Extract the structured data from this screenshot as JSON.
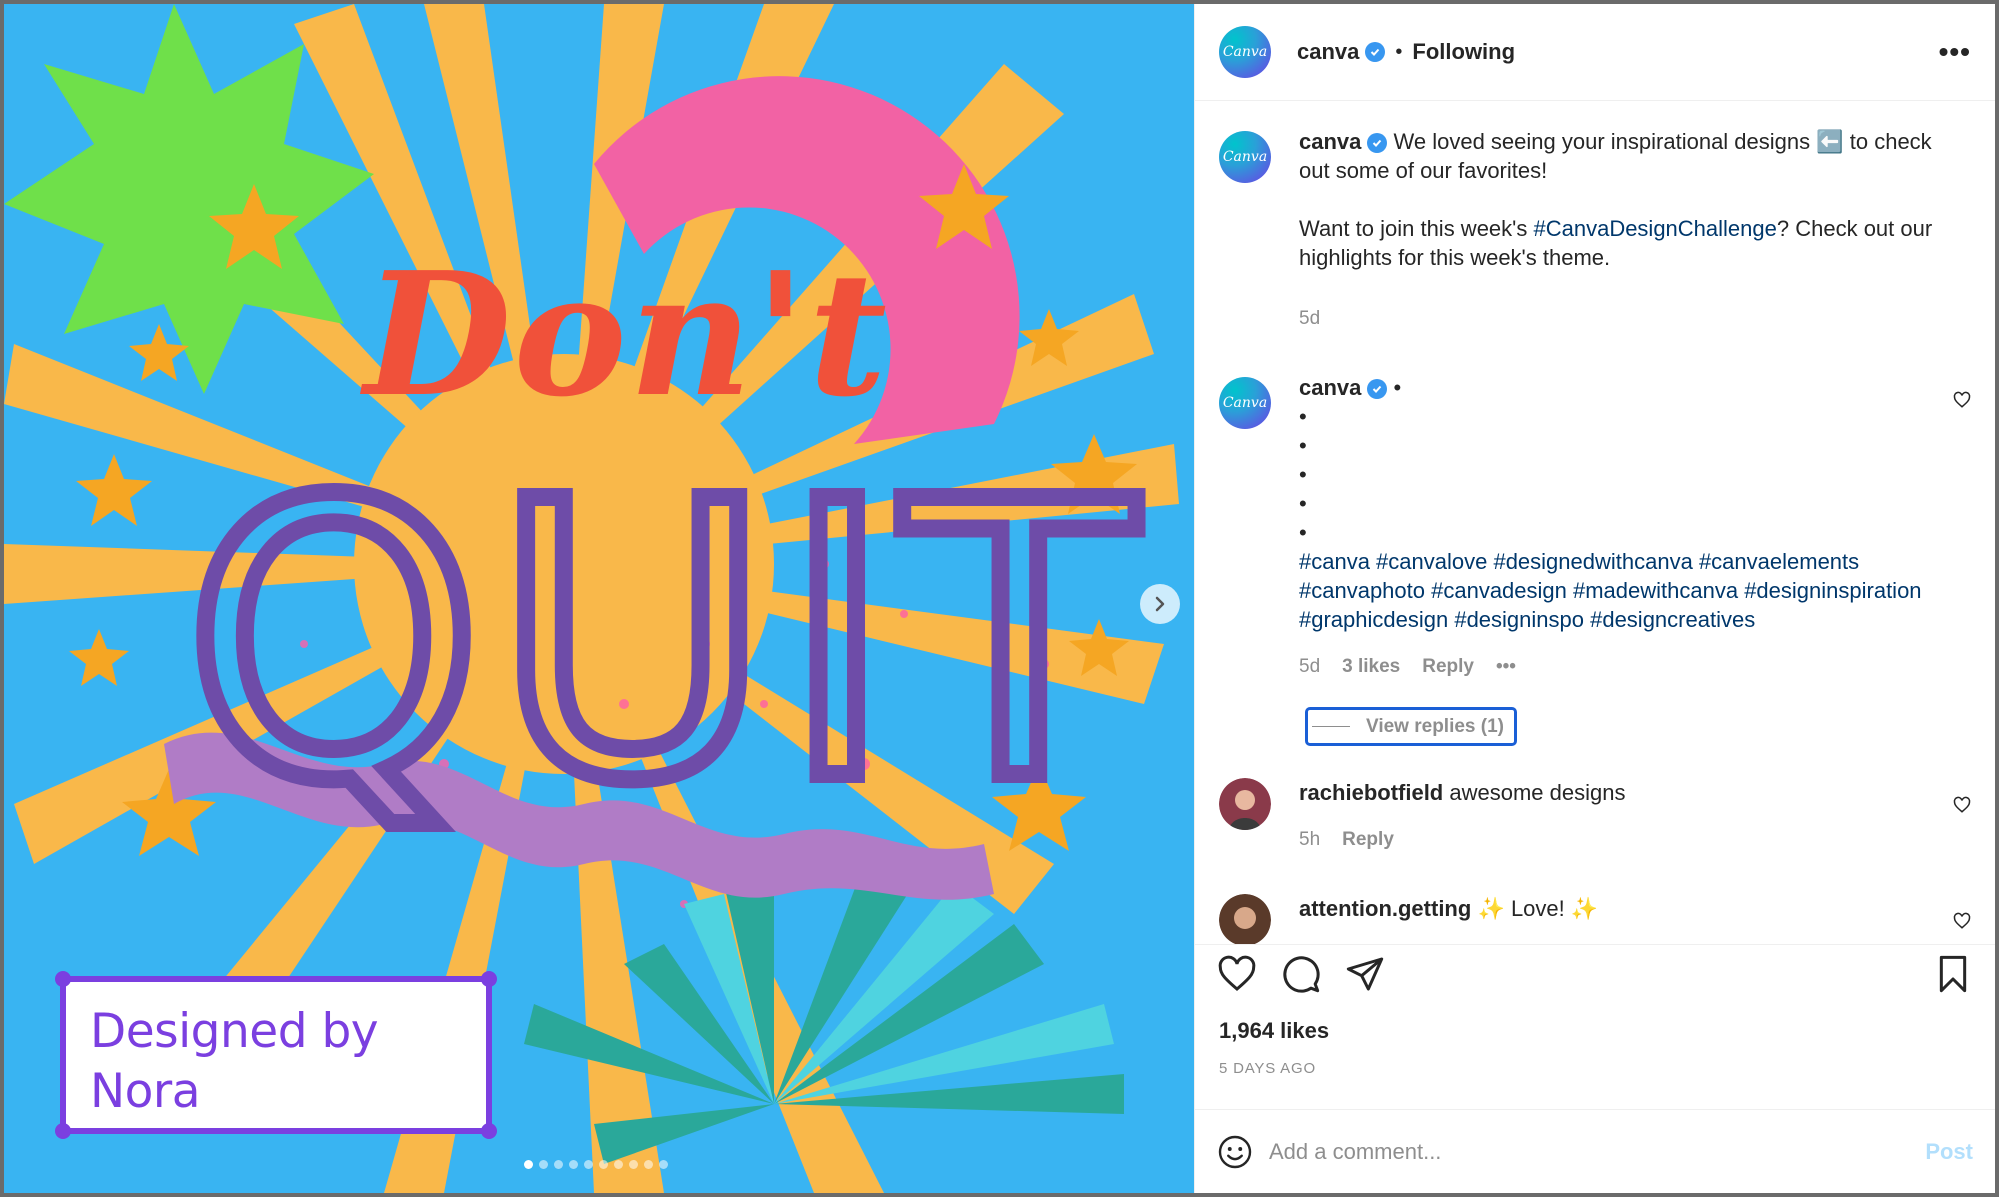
{
  "post": {
    "author": "canva",
    "follow_status": "Following",
    "more_label": "•••",
    "media": {
      "caption_line1": "Designed by",
      "caption_line2": "Nora",
      "logo_text": "Canva",
      "carousel_count": 10,
      "carousel_active": 1
    }
  },
  "comments": [
    {
      "username": "canva",
      "verified": true,
      "text": "We loved seeing your inspirational designs ⬅️ to check out some of our favorites!\n\nWant to join this week's ",
      "hashtag": "#CanvaDesignChallenge",
      "text_after": "? Check out our highlights for this week's theme.",
      "time": "5d"
    },
    {
      "username": "canva",
      "verified": true,
      "bullets": "•\n•\n•\n•\n•",
      "hashtags": "#canva #canvalove #designedwithcanva #canvaelements #canvaphoto #canvadesign #madewithcanva #designinspiration #graphicdesign #designinspo #designcreatives",
      "time": "5d",
      "likes": "3 likes",
      "reply": "Reply",
      "more": "•••",
      "view_replies": "View replies (1)"
    },
    {
      "username": "rachiebotfield",
      "text": "awesome designs",
      "time": "5h",
      "reply": "Reply"
    },
    {
      "username": "attention.getting",
      "text": "✨ Love! ✨"
    }
  ],
  "footer": {
    "likes": "1,964 likes",
    "time_ago": "5 DAYS AGO",
    "comment_placeholder": "Add a comment...",
    "post_label": "Post"
  },
  "colors": {
    "link": "#00376b",
    "verified": "#3897f0",
    "muted": "#8e8e8e",
    "post_disabled": "#b2dffc",
    "accent_purple": "#7b3fe0"
  }
}
